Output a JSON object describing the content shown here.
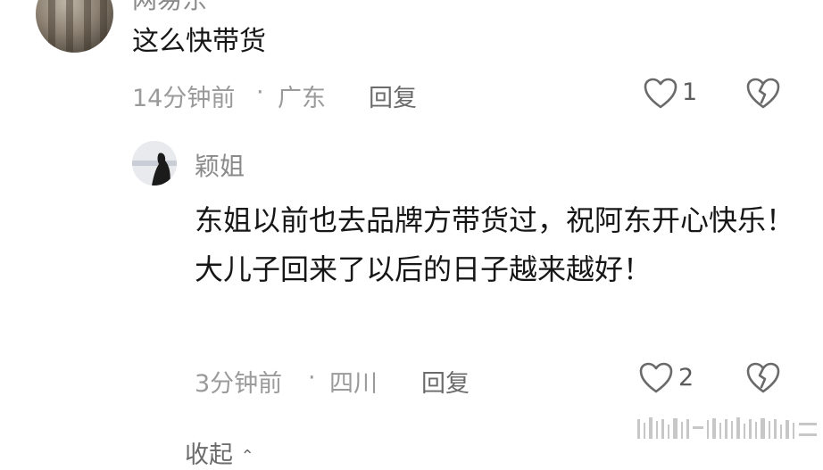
{
  "top_comment": {
    "author": "网易东",
    "text": "这么快带货",
    "time": "14分钟前",
    "location": "广东",
    "separator": "·",
    "reply_label": "回复",
    "likes": "1",
    "like_icon": "heart-outline-icon",
    "dislike_icon": "broken-heart-icon"
  },
  "reply": {
    "author": "颖姐",
    "text": "东姐以前也去品牌方带货过，祝阿东开心快乐！大儿子回来了以后的日子越来越好！",
    "time": "3分钟前",
    "location": "四川",
    "separator": "·",
    "reply_label": "回复",
    "likes": "2",
    "like_icon": "heart-outline-icon",
    "dislike_icon": "broken-heart-icon"
  },
  "collapse_label": "收起",
  "colors": {
    "text": "#161616",
    "meta": "#9a9a9a",
    "link": "#6b6b6b"
  }
}
